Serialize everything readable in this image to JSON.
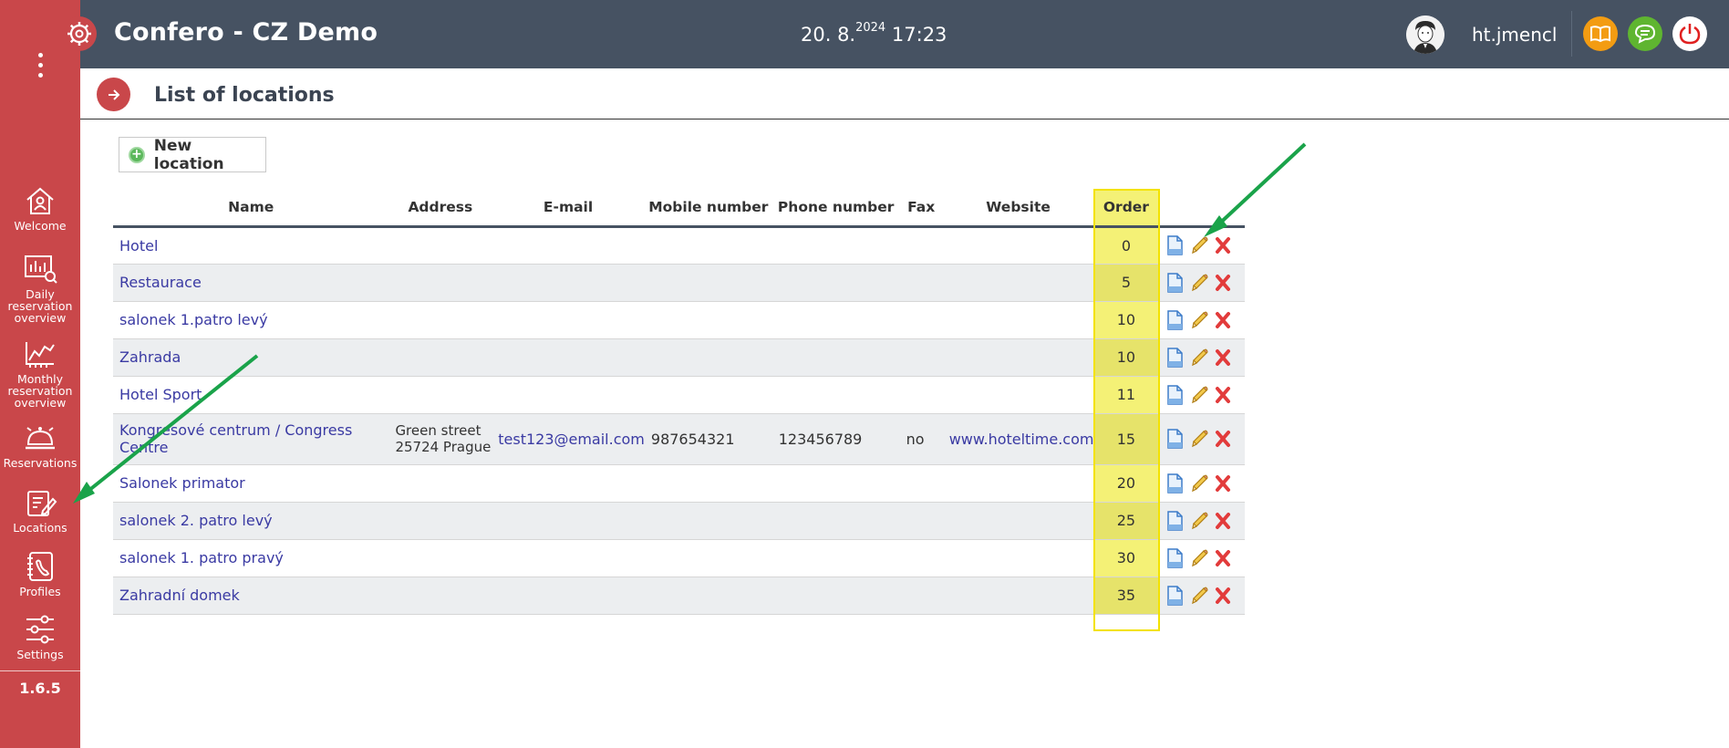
{
  "app": {
    "title": "Confero - CZ Demo",
    "date": "20. 8.",
    "year": "2024",
    "time": "17:23",
    "username": "ht.jmencl",
    "version": "1.6.5"
  },
  "sidebar": {
    "items": [
      {
        "label_lines": [
          "Welcome"
        ],
        "icon": "home-icon"
      },
      {
        "label_lines": [
          "Daily",
          "reservation",
          "overview"
        ],
        "icon": "daily-chart-icon"
      },
      {
        "label_lines": [
          "Monthly",
          "reservation",
          "overview"
        ],
        "icon": "monthly-chart-icon"
      },
      {
        "label_lines": [
          "Reservations"
        ],
        "icon": "bell-icon"
      },
      {
        "label_lines": [
          "Locations"
        ],
        "icon": "locations-icon"
      },
      {
        "label_lines": [
          "Profiles"
        ],
        "icon": "profiles-icon"
      },
      {
        "label_lines": [
          "Settings"
        ],
        "icon": "settings-sliders-icon"
      }
    ]
  },
  "page": {
    "title": "List of locations",
    "new_button": "New location"
  },
  "table": {
    "headers": {
      "name": "Name",
      "address": "Address",
      "email": "E-mail",
      "mobile": "Mobile number",
      "phone": "Phone number",
      "fax": "Fax",
      "website": "Website",
      "order": "Order"
    },
    "rows": [
      {
        "name": "Hotel",
        "address_1": "",
        "address_2": "",
        "email": "",
        "mobile": "",
        "phone": "",
        "fax": "",
        "website": "",
        "order": "0"
      },
      {
        "name": "Restaurace",
        "address_1": "",
        "address_2": "",
        "email": "",
        "mobile": "",
        "phone": "",
        "fax": "",
        "website": "",
        "order": "5"
      },
      {
        "name": "salonek 1.patro levý",
        "address_1": "",
        "address_2": "",
        "email": "",
        "mobile": "",
        "phone": "",
        "fax": "",
        "website": "",
        "order": "10"
      },
      {
        "name": "Zahrada",
        "address_1": "",
        "address_2": "",
        "email": "",
        "mobile": "",
        "phone": "",
        "fax": "",
        "website": "",
        "order": "10"
      },
      {
        "name": "Hotel Sport",
        "address_1": "",
        "address_2": "",
        "email": "",
        "mobile": "",
        "phone": "",
        "fax": "",
        "website": "",
        "order": "11"
      },
      {
        "name": "Kongresové centrum / Congress Centre",
        "address_1": "Green street",
        "address_2": "25724 Prague",
        "email": "test123@email.com",
        "mobile": "987654321",
        "phone": "123456789",
        "fax": "no",
        "website": "www.hoteltime.com",
        "order": "15"
      },
      {
        "name": "Salonek primator",
        "address_1": "",
        "address_2": "",
        "email": "",
        "mobile": "",
        "phone": "",
        "fax": "",
        "website": "",
        "order": "20"
      },
      {
        "name": "salonek 2. patro levý",
        "address_1": "",
        "address_2": "",
        "email": "",
        "mobile": "",
        "phone": "",
        "fax": "",
        "website": "",
        "order": "25"
      },
      {
        "name": "salonek 1. patro pravý",
        "address_1": "",
        "address_2": "",
        "email": "",
        "mobile": "",
        "phone": "",
        "fax": "",
        "website": "",
        "order": "30"
      },
      {
        "name": "Zahradní domek",
        "address_1": "",
        "address_2": "",
        "email": "",
        "mobile": "",
        "phone": "",
        "fax": "",
        "website": "",
        "order": "35"
      }
    ]
  },
  "colors": {
    "sidebar": "#c9474a",
    "topbar": "#465262",
    "order_highlight": "#f4f176",
    "arrow": "#1aa34a",
    "help_button": "#f39c12",
    "chat_button": "#5fb530",
    "power_button": "#ffffff"
  }
}
